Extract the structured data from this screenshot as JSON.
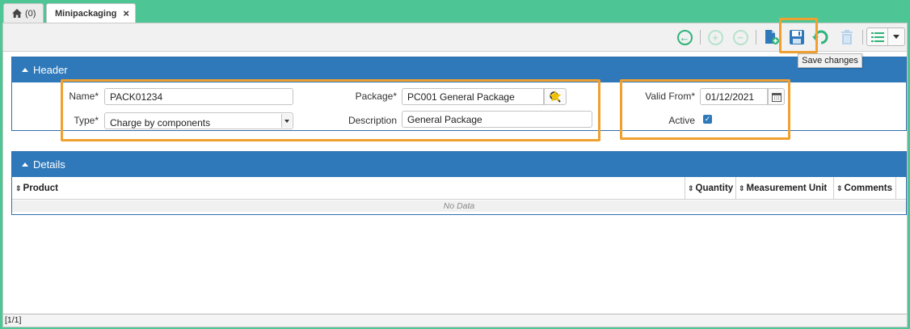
{
  "tabs": {
    "home_count": "(0)",
    "active_label": "Minipackaging",
    "close_glyph": "×"
  },
  "toolbar": {
    "back_icon": "←",
    "add_icon": "+",
    "remove_icon": "−",
    "tooltip": "Save changes",
    "highlight_color": "#f0a030"
  },
  "header_panel": {
    "title": "Header",
    "name_label": "Name*",
    "name_value": "PACK01234",
    "type_label": "Type*",
    "type_value": "Charge by components",
    "package_label": "Package*",
    "package_value": "PC001 General Package",
    "description_label": "Description",
    "description_value": "General Package",
    "valid_from_label": "Valid From*",
    "valid_from_value": "01/12/2021",
    "active_label": "Active",
    "active_checked": "✓"
  },
  "details_panel": {
    "title": "Details",
    "columns": [
      "Product",
      "Quantity",
      "Measurement Unit",
      "Comments"
    ],
    "empty_text": "No Data",
    "sort_glyph": "⇕"
  },
  "status": {
    "pager": "[1/1]"
  },
  "colors": {
    "accent_green": "#4ec595",
    "panel_blue": "#2f79ba"
  }
}
